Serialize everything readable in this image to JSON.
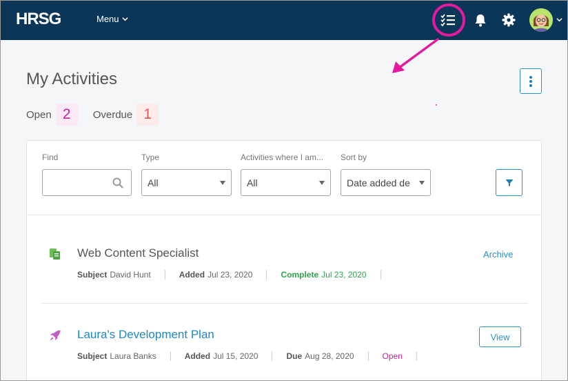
{
  "nav": {
    "logo": "HRSG",
    "menu_label": "Menu",
    "icons": [
      "activities-list-icon",
      "bell-icon",
      "gear-icon",
      "avatar"
    ]
  },
  "page": {
    "title": "My Activities",
    "open_label": "Open",
    "open_count": "2",
    "overdue_label": "Overdue",
    "overdue_count": "1"
  },
  "filters": {
    "find_label": "Find",
    "find_value": "",
    "type_label": "Type",
    "type_value": "All",
    "role_label": "Activities where I am...",
    "role_value": "All",
    "sort_label": "Sort by",
    "sort_value": "Date added de"
  },
  "activities": [
    {
      "title": "Web Content Specialist",
      "subject_label": "Subject",
      "subject": "David Hunt",
      "added_label": "Added",
      "added": "Jul 23, 2020",
      "status_label": "Complete",
      "status_date": "Jul 23, 2020",
      "action": "Archive",
      "icon": "documents-icon"
    },
    {
      "title": "Laura's Development Plan",
      "subject_label": "Subject",
      "subject": "Laura Banks",
      "added_label": "Added",
      "added": "Jul 15, 2020",
      "due_label": "Due",
      "due": "Aug 28, 2020",
      "status": "Open",
      "action": "View",
      "icon": "rocket-icon"
    }
  ],
  "colors": {
    "nav_bg": "#0b3658",
    "accent": "#2a8fc4",
    "highlight": "#e21b9e",
    "open": "#c0239a",
    "overdue": "#e25656",
    "complete": "#2ea34a"
  }
}
